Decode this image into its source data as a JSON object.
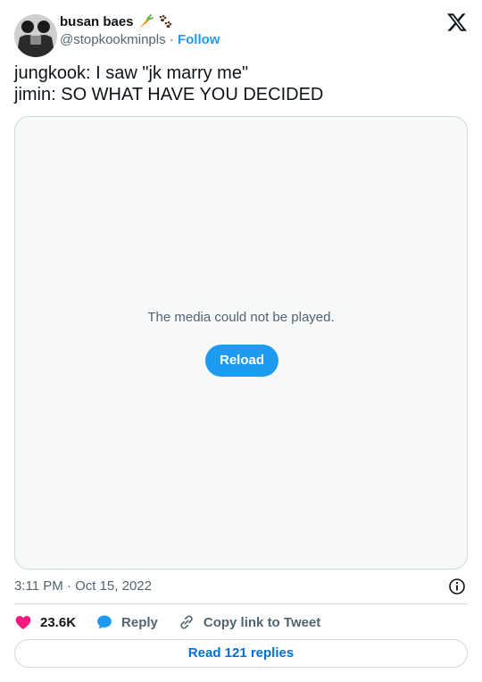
{
  "author": {
    "display_name": "busan baes",
    "emojis": [
      "carrot-emoji",
      "paw-prints-emoji"
    ],
    "handle": "@stopkookminpls",
    "separator": "·",
    "follow_label": "Follow"
  },
  "tweet": {
    "lines": [
      "jungkook: I saw \"jk marry me\"",
      "jimin: SO WHAT HAVE YOU DECIDED"
    ]
  },
  "media": {
    "message": "The media could not be played.",
    "reload_label": "Reload"
  },
  "meta": {
    "timestamp": "3:11 PM · Oct 15, 2022"
  },
  "actions": {
    "likes": "23.6K",
    "reply_label": "Reply",
    "copy_link_label": "Copy link to Tweet"
  },
  "footer": {
    "read_replies_label": "Read 121 replies"
  },
  "icons": {
    "logo": "x-logo-icon",
    "info": "info-icon",
    "like": "heart-icon",
    "reply": "speech-bubble-icon",
    "copy": "link-icon"
  },
  "colors": {
    "accent": "#1d9bf0",
    "link": "#006fd6",
    "heart": "#f91880",
    "muted": "#536471",
    "border": "#cfd9de",
    "media_bg": "#f7f9f9"
  }
}
